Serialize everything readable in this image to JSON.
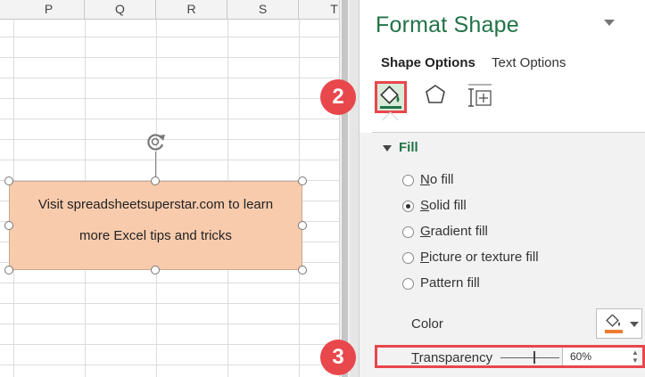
{
  "sheet": {
    "columns": [
      "P",
      "Q",
      "R",
      "S",
      "T"
    ],
    "shape": {
      "line1": "Visit spreadsheetsuperstar.com to learn",
      "line2": "more Excel tips and tricks",
      "fill_color": "#f8cbad"
    }
  },
  "pane": {
    "title": "Format Shape",
    "tabs": [
      {
        "label": "Shape Options",
        "active": true
      },
      {
        "label": "Text Options",
        "active": false
      }
    ],
    "icons": [
      "fill-line-icon",
      "effects-pentagon-icon",
      "size-properties-icon"
    ],
    "fill": {
      "section_title": "Fill",
      "options": [
        {
          "label": "No fill",
          "selected": false
        },
        {
          "label": "Solid fill",
          "selected": true
        },
        {
          "label": "Gradient fill",
          "selected": false
        },
        {
          "label": "Picture or texture fill",
          "selected": false
        },
        {
          "label": "Pattern fill",
          "selected": false
        }
      ],
      "color_label": "Color",
      "color_swatch": "#ed7d31",
      "transparency_label": "Transparency",
      "transparency_value": "60%"
    }
  },
  "annotations": {
    "step2": "2",
    "step3": "3",
    "accent": "#e8474c"
  },
  "theme": {
    "excel_green": "#217346"
  }
}
